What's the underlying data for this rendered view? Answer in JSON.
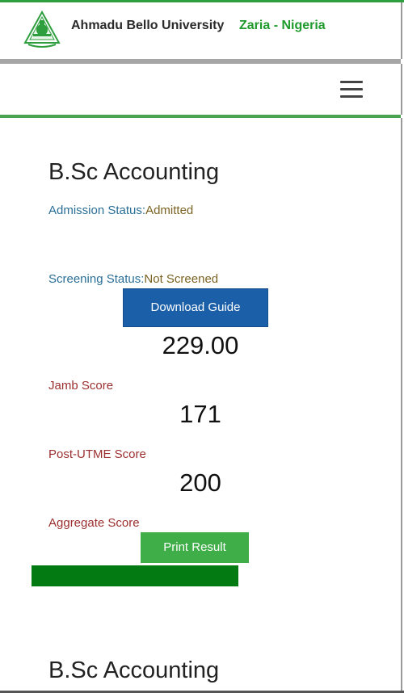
{
  "header": {
    "university_name": "Ahmadu Bello University",
    "location": "Zaria - Nigeria",
    "logo_icon": "abu-crest-icon",
    "brand_green": "#1f9a2c"
  },
  "nav": {
    "menu_icon": "hamburger-menu-icon"
  },
  "cards": [
    {
      "programme": "B.Sc Accounting",
      "admission_status_label": "Admission Status:",
      "admission_status_value": "Admitted",
      "screening_status_label": "Screening Status:",
      "screening_status_value": "Not Screened",
      "download_button_label": "Download Guide",
      "jamb_score_value": "229.00",
      "jamb_score_label": "Jamb Score",
      "post_utme_value": "171",
      "post_utme_label": "Post-UTME Score",
      "aggregate_value": "200",
      "aggregate_label": "Aggregate Score",
      "print_button_label": "Print Result",
      "progress_fraction": 1.0
    },
    {
      "programme": "B.Sc Accounting"
    }
  ],
  "colors": {
    "download_button": "#1a5fa8",
    "print_button": "#3fae48",
    "progress": "#047a12",
    "score_label": "#9c2f2f",
    "status_label": "#2a6f97",
    "status_value": "#7a6322"
  }
}
